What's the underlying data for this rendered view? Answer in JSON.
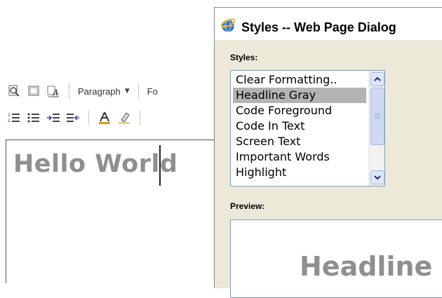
{
  "editor": {
    "toolbar": {
      "paragraph_label": "Paragraph",
      "next_label": "Fo"
    },
    "content": "Hello World"
  },
  "dialog": {
    "title": "Styles -- Web Page Dialog",
    "styles_label": "Styles:",
    "styles": [
      "Clear Formatting..",
      "Headline Gray",
      "Code Foreground",
      "Code In Text",
      "Screen Text",
      "Important Words",
      "Highlight"
    ],
    "selected_style": "Headline Gray",
    "preview_label": "Preview:",
    "preview_text": "Headline"
  },
  "colors": {
    "dialog_bg": "#ece9d8",
    "selection": "#b3b3b3",
    "headline_gray": "#8f8f8f",
    "list_border": "#7f9db9"
  }
}
